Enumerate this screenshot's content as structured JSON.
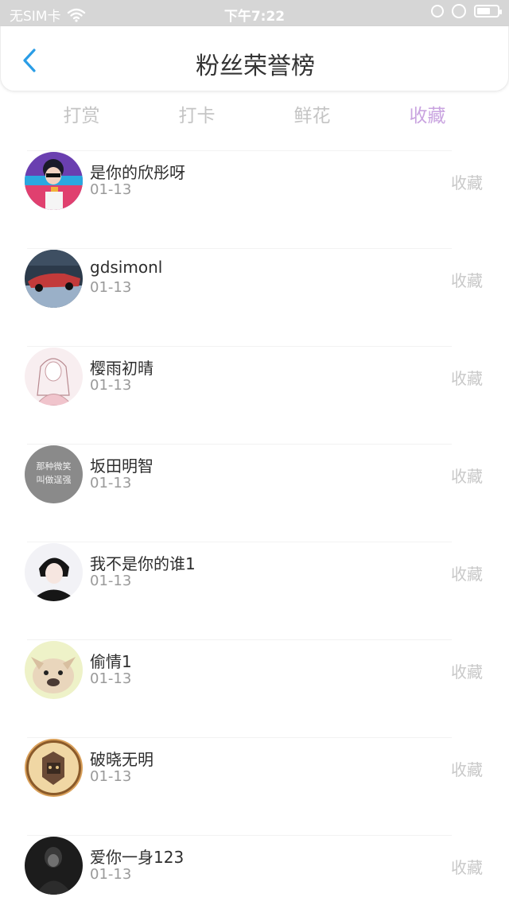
{
  "status_bar": {
    "carrier": "无SIM卡",
    "time": "下午7:22"
  },
  "header": {
    "title": "粉丝荣誉榜"
  },
  "tabs": [
    {
      "label": "打赏"
    },
    {
      "label": "打卡"
    },
    {
      "label": "鲜花"
    },
    {
      "label": "收藏"
    }
  ],
  "active_tab_color": "#c9a4e0",
  "fans": [
    {
      "name": "是你的欣彤呀",
      "date": "01-13",
      "action": "收藏"
    },
    {
      "name": "gdsimonl",
      "date": "01-13",
      "action": "收藏"
    },
    {
      "name": "樱雨初晴",
      "date": "01-13",
      "action": "收藏"
    },
    {
      "name": "坂田明智",
      "date": "01-13",
      "action": "收藏",
      "avatar_text_line1": "那种微笑",
      "avatar_text_line2": "叫做逞强"
    },
    {
      "name": "我不是你的谁1",
      "date": "01-13",
      "action": "收藏"
    },
    {
      "name": "偷情1",
      "date": "01-13",
      "action": "收藏"
    },
    {
      "name": "破晓无明",
      "date": "01-13",
      "action": "收藏"
    },
    {
      "name": "爱你一身123",
      "date": "01-13",
      "action": "收藏"
    }
  ]
}
